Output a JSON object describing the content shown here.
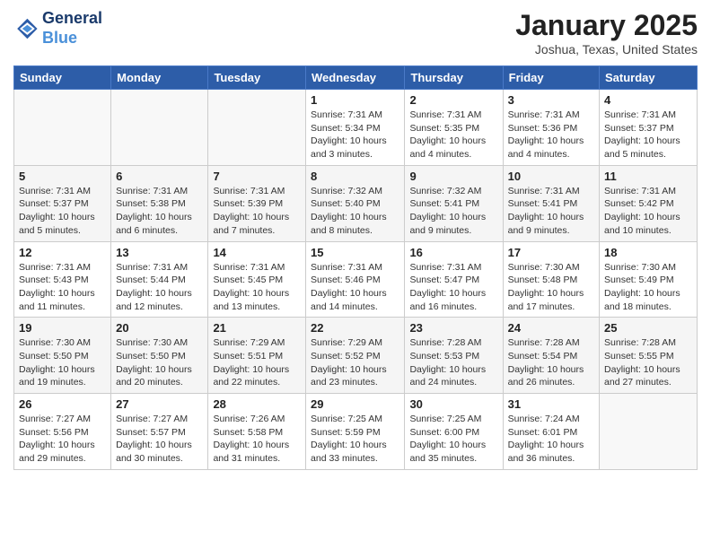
{
  "header": {
    "logo_line1": "General",
    "logo_line2": "Blue",
    "month_title": "January 2025",
    "location": "Joshua, Texas, United States"
  },
  "weekdays": [
    "Sunday",
    "Monday",
    "Tuesday",
    "Wednesday",
    "Thursday",
    "Friday",
    "Saturday"
  ],
  "weeks": [
    [
      {
        "day": "",
        "sunrise": "",
        "sunset": "",
        "daylight": ""
      },
      {
        "day": "",
        "sunrise": "",
        "sunset": "",
        "daylight": ""
      },
      {
        "day": "",
        "sunrise": "",
        "sunset": "",
        "daylight": ""
      },
      {
        "day": "1",
        "sunrise": "Sunrise: 7:31 AM",
        "sunset": "Sunset: 5:34 PM",
        "daylight": "Daylight: 10 hours and 3 minutes."
      },
      {
        "day": "2",
        "sunrise": "Sunrise: 7:31 AM",
        "sunset": "Sunset: 5:35 PM",
        "daylight": "Daylight: 10 hours and 4 minutes."
      },
      {
        "day": "3",
        "sunrise": "Sunrise: 7:31 AM",
        "sunset": "Sunset: 5:36 PM",
        "daylight": "Daylight: 10 hours and 4 minutes."
      },
      {
        "day": "4",
        "sunrise": "Sunrise: 7:31 AM",
        "sunset": "Sunset: 5:37 PM",
        "daylight": "Daylight: 10 hours and 5 minutes."
      }
    ],
    [
      {
        "day": "5",
        "sunrise": "Sunrise: 7:31 AM",
        "sunset": "Sunset: 5:37 PM",
        "daylight": "Daylight: 10 hours and 5 minutes."
      },
      {
        "day": "6",
        "sunrise": "Sunrise: 7:31 AM",
        "sunset": "Sunset: 5:38 PM",
        "daylight": "Daylight: 10 hours and 6 minutes."
      },
      {
        "day": "7",
        "sunrise": "Sunrise: 7:31 AM",
        "sunset": "Sunset: 5:39 PM",
        "daylight": "Daylight: 10 hours and 7 minutes."
      },
      {
        "day": "8",
        "sunrise": "Sunrise: 7:32 AM",
        "sunset": "Sunset: 5:40 PM",
        "daylight": "Daylight: 10 hours and 8 minutes."
      },
      {
        "day": "9",
        "sunrise": "Sunrise: 7:32 AM",
        "sunset": "Sunset: 5:41 PM",
        "daylight": "Daylight: 10 hours and 9 minutes."
      },
      {
        "day": "10",
        "sunrise": "Sunrise: 7:31 AM",
        "sunset": "Sunset: 5:41 PM",
        "daylight": "Daylight: 10 hours and 9 minutes."
      },
      {
        "day": "11",
        "sunrise": "Sunrise: 7:31 AM",
        "sunset": "Sunset: 5:42 PM",
        "daylight": "Daylight: 10 hours and 10 minutes."
      }
    ],
    [
      {
        "day": "12",
        "sunrise": "Sunrise: 7:31 AM",
        "sunset": "Sunset: 5:43 PM",
        "daylight": "Daylight: 10 hours and 11 minutes."
      },
      {
        "day": "13",
        "sunrise": "Sunrise: 7:31 AM",
        "sunset": "Sunset: 5:44 PM",
        "daylight": "Daylight: 10 hours and 12 minutes."
      },
      {
        "day": "14",
        "sunrise": "Sunrise: 7:31 AM",
        "sunset": "Sunset: 5:45 PM",
        "daylight": "Daylight: 10 hours and 13 minutes."
      },
      {
        "day": "15",
        "sunrise": "Sunrise: 7:31 AM",
        "sunset": "Sunset: 5:46 PM",
        "daylight": "Daylight: 10 hours and 14 minutes."
      },
      {
        "day": "16",
        "sunrise": "Sunrise: 7:31 AM",
        "sunset": "Sunset: 5:47 PM",
        "daylight": "Daylight: 10 hours and 16 minutes."
      },
      {
        "day": "17",
        "sunrise": "Sunrise: 7:30 AM",
        "sunset": "Sunset: 5:48 PM",
        "daylight": "Daylight: 10 hours and 17 minutes."
      },
      {
        "day": "18",
        "sunrise": "Sunrise: 7:30 AM",
        "sunset": "Sunset: 5:49 PM",
        "daylight": "Daylight: 10 hours and 18 minutes."
      }
    ],
    [
      {
        "day": "19",
        "sunrise": "Sunrise: 7:30 AM",
        "sunset": "Sunset: 5:50 PM",
        "daylight": "Daylight: 10 hours and 19 minutes."
      },
      {
        "day": "20",
        "sunrise": "Sunrise: 7:30 AM",
        "sunset": "Sunset: 5:50 PM",
        "daylight": "Daylight: 10 hours and 20 minutes."
      },
      {
        "day": "21",
        "sunrise": "Sunrise: 7:29 AM",
        "sunset": "Sunset: 5:51 PM",
        "daylight": "Daylight: 10 hours and 22 minutes."
      },
      {
        "day": "22",
        "sunrise": "Sunrise: 7:29 AM",
        "sunset": "Sunset: 5:52 PM",
        "daylight": "Daylight: 10 hours and 23 minutes."
      },
      {
        "day": "23",
        "sunrise": "Sunrise: 7:28 AM",
        "sunset": "Sunset: 5:53 PM",
        "daylight": "Daylight: 10 hours and 24 minutes."
      },
      {
        "day": "24",
        "sunrise": "Sunrise: 7:28 AM",
        "sunset": "Sunset: 5:54 PM",
        "daylight": "Daylight: 10 hours and 26 minutes."
      },
      {
        "day": "25",
        "sunrise": "Sunrise: 7:28 AM",
        "sunset": "Sunset: 5:55 PM",
        "daylight": "Daylight: 10 hours and 27 minutes."
      }
    ],
    [
      {
        "day": "26",
        "sunrise": "Sunrise: 7:27 AM",
        "sunset": "Sunset: 5:56 PM",
        "daylight": "Daylight: 10 hours and 29 minutes."
      },
      {
        "day": "27",
        "sunrise": "Sunrise: 7:27 AM",
        "sunset": "Sunset: 5:57 PM",
        "daylight": "Daylight: 10 hours and 30 minutes."
      },
      {
        "day": "28",
        "sunrise": "Sunrise: 7:26 AM",
        "sunset": "Sunset: 5:58 PM",
        "daylight": "Daylight: 10 hours and 31 minutes."
      },
      {
        "day": "29",
        "sunrise": "Sunrise: 7:25 AM",
        "sunset": "Sunset: 5:59 PM",
        "daylight": "Daylight: 10 hours and 33 minutes."
      },
      {
        "day": "30",
        "sunrise": "Sunrise: 7:25 AM",
        "sunset": "Sunset: 6:00 PM",
        "daylight": "Daylight: 10 hours and 35 minutes."
      },
      {
        "day": "31",
        "sunrise": "Sunrise: 7:24 AM",
        "sunset": "Sunset: 6:01 PM",
        "daylight": "Daylight: 10 hours and 36 minutes."
      },
      {
        "day": "",
        "sunrise": "",
        "sunset": "",
        "daylight": ""
      }
    ]
  ]
}
